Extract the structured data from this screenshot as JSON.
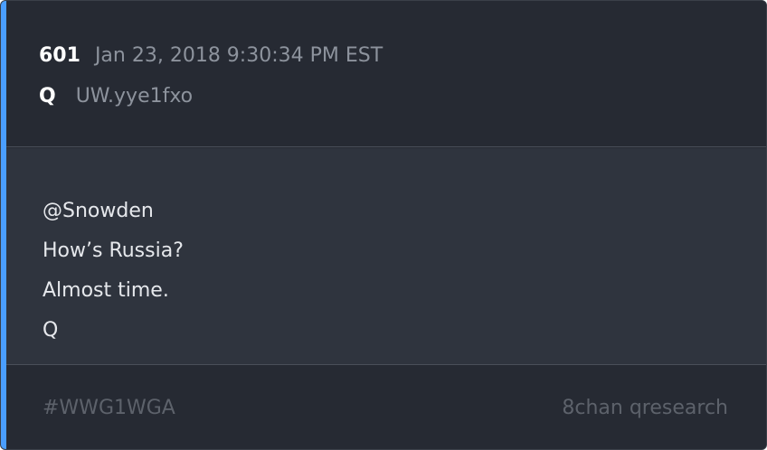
{
  "post": {
    "number": "601",
    "timestamp": "Jan 23, 2018 9:30:34 PM EST",
    "author": "Q",
    "tripcode": "UW.yye1fxo",
    "lines": [
      "@Snowden",
      "How’s Russia?",
      "Almost time.",
      "Q"
    ]
  },
  "footer": {
    "hashtag": "#WWG1WGA",
    "source": "8chan qresearch"
  },
  "colors": {
    "accent": "#4a9eff",
    "card_bg": "#262a33",
    "body_bg": "#2f343e",
    "muted_text": "#8d939d"
  }
}
